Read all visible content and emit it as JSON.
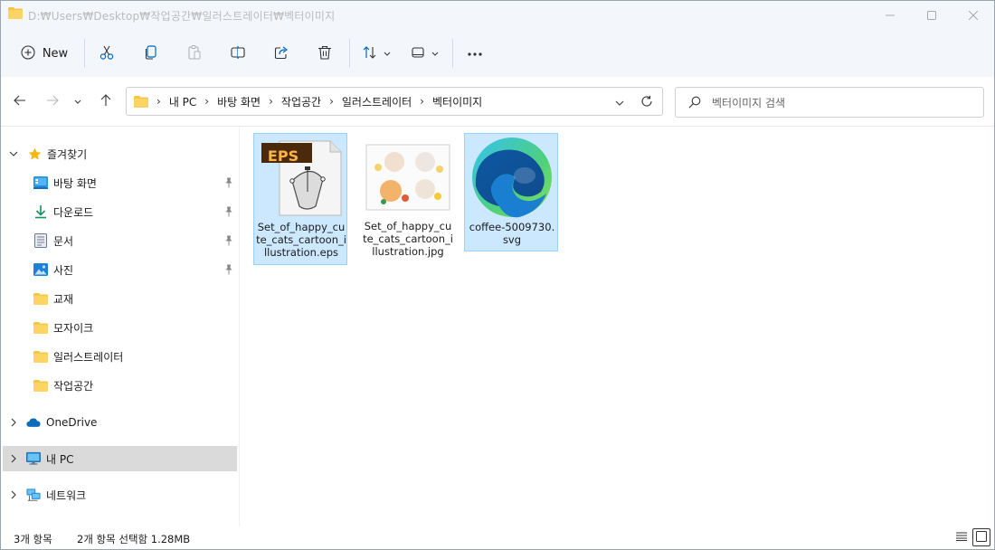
{
  "window": {
    "title": "D:₩Users₩Desktop₩작업공간₩일러스트레이터₩벡터이미지",
    "folder_color": "#f8c446"
  },
  "toolbar": {
    "new_label": "New",
    "icons": [
      "cut-icon",
      "copy-icon",
      "paste-icon",
      "rename-icon",
      "share-icon",
      "delete-icon",
      "sort-icon",
      "view-icon",
      "more-icon"
    ]
  },
  "address": {
    "crumbs": [
      "내 PC",
      "바탕 화면",
      "작업공간",
      "일러스트레이터",
      "벡터이미지"
    ],
    "search_placeholder": "벡터이미지 검색"
  },
  "sidebar": {
    "favorites_label": "즐겨찾기",
    "favorites": [
      {
        "label": "바탕 화면",
        "icon": "desktop-icon",
        "pinned": true
      },
      {
        "label": "다운로드",
        "icon": "download-icon",
        "pinned": true
      },
      {
        "label": "문서",
        "icon": "document-icon",
        "pinned": true
      },
      {
        "label": "사진",
        "icon": "pictures-icon",
        "pinned": true
      },
      {
        "label": "교재",
        "icon": "folder-icon",
        "pinned": false
      },
      {
        "label": "모자이크",
        "icon": "folder-icon",
        "pinned": false
      },
      {
        "label": "일러스트레이터",
        "icon": "folder-icon",
        "pinned": false
      },
      {
        "label": "작업공간",
        "icon": "folder-icon",
        "pinned": false
      }
    ],
    "onedrive_label": "OneDrive",
    "thispc_label": "내 PC",
    "network_label": "네트워크"
  },
  "files": [
    {
      "name": "Set_of_happy_cute_cats_cartoon_illustration.eps",
      "type": "eps",
      "badge": "EPS",
      "selected": true
    },
    {
      "name": "Set_of_happy_cute_cats_cartoon_illustration.jpg",
      "type": "jpg",
      "selected": false
    },
    {
      "name": "coffee-5009730.svg",
      "type": "svg",
      "selected": true
    }
  ],
  "status": {
    "count": "3개 항목",
    "selection": "2개 항목 선택함 1.28MB"
  },
  "colors": {
    "accent": "#0067c0",
    "selection_bg": "#cce8ff",
    "selection_border": "#99d1ff",
    "star": "#f6b800"
  }
}
